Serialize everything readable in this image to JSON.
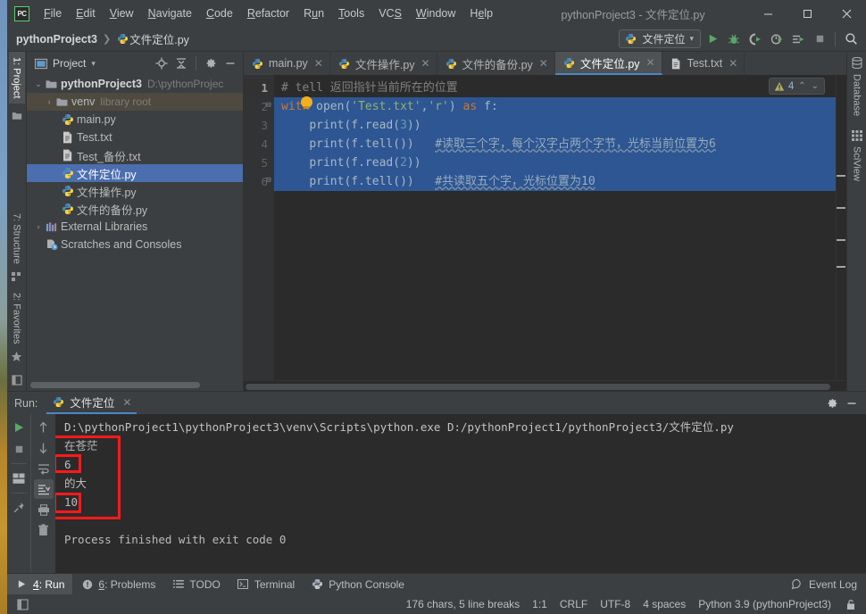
{
  "window": {
    "title": "pythonProject3 - 文件定位.py",
    "minimize": "—",
    "maximize": "▢",
    "close": "✕",
    "logo_text": "PC"
  },
  "menu": [
    {
      "label": "File"
    },
    {
      "label": "Edit"
    },
    {
      "label": "View"
    },
    {
      "label": "Navigate"
    },
    {
      "label": "Code"
    },
    {
      "label": "Refactor"
    },
    {
      "label": "Run"
    },
    {
      "label": "Tools"
    },
    {
      "label": "VCS"
    },
    {
      "label": "Window"
    },
    {
      "label": "Help"
    }
  ],
  "breadcrumb": {
    "project": "pythonProject3",
    "separator": "❯",
    "file": "文件定位.py"
  },
  "toolbar": {
    "run_config": "文件定位",
    "run_config_caret": "▾",
    "icons": [
      {
        "name": "run-icon",
        "glyph": "▶"
      },
      {
        "name": "debug-icon",
        "glyph": "🐞"
      },
      {
        "name": "run-coverage-icon",
        "glyph": "◐"
      },
      {
        "name": "profile-icon",
        "glyph": "◔"
      },
      {
        "name": "run-with-options-icon",
        "glyph": "≡"
      },
      {
        "name": "stop-icon",
        "glyph": "■"
      },
      {
        "name": "search-everywhere-icon",
        "glyph": "⌕"
      }
    ]
  },
  "left_strip": {
    "project_tab": "1: Project",
    "structure_tab": "7: Structure",
    "favorites_tab": "2: Favorites"
  },
  "right_strip": {
    "database_tab": "Database",
    "sciview_tab": "SciView"
  },
  "project_panel": {
    "title": "Project",
    "title_caret": "▾",
    "tools": [
      "locate-icon",
      "collapse-all-icon",
      "settings-icon",
      "hide-icon"
    ],
    "tree": [
      {
        "indent": 0,
        "arrow": "⌄",
        "icon": "folder-icon",
        "label": "pythonProject3",
        "dim": "D:\\pythonProjec",
        "bold": true,
        "state": "normal"
      },
      {
        "indent": 1,
        "arrow": "›",
        "icon": "folder-icon",
        "label": "venv",
        "dim": "library root",
        "bold": false,
        "state": "highlight"
      },
      {
        "indent": 2,
        "arrow": "",
        "icon": "python-file-icon",
        "label": "main.py",
        "dim": "",
        "bold": false,
        "state": "normal"
      },
      {
        "indent": 2,
        "arrow": "",
        "icon": "text-file-icon",
        "label": "Test.txt",
        "dim": "",
        "bold": false,
        "state": "normal"
      },
      {
        "indent": 2,
        "arrow": "",
        "icon": "text-file-icon",
        "label": "Test_备份.txt",
        "dim": "",
        "bold": false,
        "state": "normal"
      },
      {
        "indent": 2,
        "arrow": "",
        "icon": "python-file-icon",
        "label": "文件定位.py",
        "dim": "",
        "bold": false,
        "state": "selected"
      },
      {
        "indent": 2,
        "arrow": "",
        "icon": "python-file-icon",
        "label": "文件操作.py",
        "dim": "",
        "bold": false,
        "state": "normal"
      },
      {
        "indent": 2,
        "arrow": "",
        "icon": "python-file-icon",
        "label": "文件的备份.py",
        "dim": "",
        "bold": false,
        "state": "normal"
      },
      {
        "indent": 0,
        "arrow": "›",
        "icon": "library-icon",
        "label": "External Libraries",
        "dim": "",
        "bold": false,
        "state": "normal"
      },
      {
        "indent": 0,
        "arrow": "",
        "icon": "scratches-icon",
        "label": "Scratches and Consoles",
        "dim": "",
        "bold": false,
        "state": "normal"
      }
    ]
  },
  "editor_tabs": [
    {
      "label": "main.py",
      "icon": "python-file-icon",
      "active": false,
      "close": "✕"
    },
    {
      "label": "文件操作.py",
      "icon": "python-file-icon",
      "active": false,
      "close": "✕"
    },
    {
      "label": "文件的备份.py",
      "icon": "python-file-icon",
      "active": false,
      "close": "✕"
    },
    {
      "label": "文件定位.py",
      "icon": "python-file-icon",
      "active": true,
      "close": "✕"
    },
    {
      "label": "Test.txt",
      "icon": "text-file-icon",
      "active": false,
      "close": "✕"
    }
  ],
  "inspection": {
    "warning_glyph": "⚠",
    "count": "4",
    "prev": "⌃",
    "next": "⌄"
  },
  "editor": {
    "line_numbers": [
      "1",
      "2",
      "3",
      "4",
      "5",
      "6"
    ],
    "lines": [
      {
        "n": 1,
        "selected": false,
        "fold": "",
        "code": "# tell 返回指针当前所在的位置",
        "kind": "comment"
      },
      {
        "n": 2,
        "selected": true,
        "fold": "⊟",
        "code": "with open('Test.txt','r') as f:",
        "kind": "code"
      },
      {
        "n": 3,
        "selected": true,
        "fold": "",
        "code": "    print(f.read(3))",
        "kind": "code"
      },
      {
        "n": 4,
        "selected": true,
        "fold": "",
        "code": "    print(f.tell())   #读取三个字，每个汉字占两个字节，光标当前位置为6",
        "kind": "code"
      },
      {
        "n": 5,
        "selected": true,
        "fold": "",
        "code": "    print(f.read(2))",
        "kind": "code"
      },
      {
        "n": 6,
        "selected": true,
        "fold": "⊟",
        "code": "    print(f.tell())   #共读取五个字，光标位置为10",
        "kind": "code"
      }
    ],
    "comment_line4": "#读取三个字，每个汉字占两个字节，光标当前位置为6",
    "comment_line6": "#共读取五个字，光标位置为10"
  },
  "run_panel": {
    "label": "Run:",
    "tab_label": "文件定位",
    "tab_close": "✕",
    "settings_icon": "⚙",
    "hide_icon": "—",
    "side_buttons": [
      {
        "name": "rerun-button",
        "glyph": "▶"
      },
      {
        "name": "stop-button",
        "glyph": "■"
      },
      {
        "name": "console-toggle-button",
        "glyph": "▤"
      },
      {
        "name": "pin-tab-button",
        "glyph": "📌"
      }
    ],
    "side_buttons2": [
      {
        "name": "up-arrow-button",
        "glyph": "↑"
      },
      {
        "name": "down-arrow-button",
        "glyph": "↓"
      },
      {
        "name": "soft-wrap-button",
        "glyph": "⇥"
      },
      {
        "name": "scroll-to-end-button",
        "glyph": "⇟"
      },
      {
        "name": "print-button",
        "glyph": "🖶"
      },
      {
        "name": "clear-all-button",
        "glyph": "🗑"
      }
    ],
    "output": [
      "D:\\pythonProject1\\pythonProject3\\venv\\Scripts\\python.exe D:/pythonProject1/pythonProject3/文件定位.py",
      "在苍茫",
      "6",
      "的大",
      "10",
      "",
      "Process finished with exit code 0"
    ],
    "annotation_color": "#ff1a1a"
  },
  "tool_window_bar": {
    "items": [
      {
        "label": "4: Run",
        "underline": "4",
        "icon": "run-icon",
        "active": true
      },
      {
        "label": "6: Problems",
        "underline": "6",
        "icon": "problems-icon",
        "active": false
      },
      {
        "label": "TODO",
        "underline": "",
        "icon": "todo-icon",
        "active": false
      },
      {
        "label": "Terminal",
        "underline": "",
        "icon": "terminal-icon",
        "active": false
      },
      {
        "label": "Python Console",
        "underline": "",
        "icon": "python-console-icon",
        "active": false
      }
    ],
    "event_log": "Event Log",
    "event_log_icon": "event-log-icon"
  },
  "status_bar": {
    "left_icon": "toggle-toolwindows-icon",
    "chars": "176 chars, 5 line breaks",
    "caret": "1:1",
    "line_sep": "CRLF",
    "encoding": "UTF-8",
    "indent": "4 spaces",
    "interpreter": "Python 3.9 (pythonProject3)",
    "lock_icon": "lock-icon"
  },
  "colors": {
    "window_bg": "#3c3f41",
    "editor_bg": "#2b2b2b",
    "selection_blue": "#2d5692",
    "tree_selection": "#4b6eaf",
    "accent_blue": "#4a88c7",
    "annotation_red": "#ff1a1a",
    "run_green": "#499c54"
  }
}
